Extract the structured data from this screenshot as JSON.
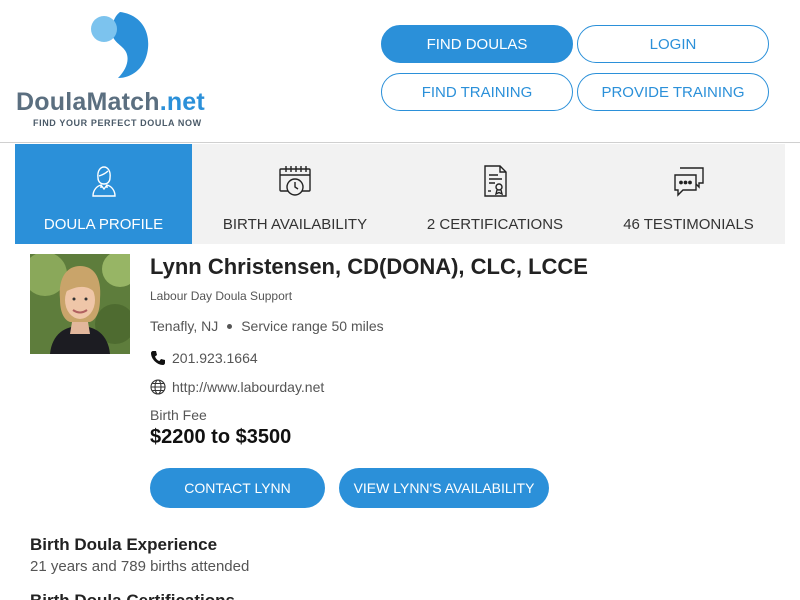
{
  "brand": {
    "name_main": "DoulaMatch",
    "name_suffix": ".net",
    "tagline": "FIND YOUR PERFECT DOULA NOW",
    "accent_color": "#2b90d9"
  },
  "nav": {
    "find_doulas": "FIND DOULAS",
    "login": "LOGIN",
    "find_training": "FIND TRAINING",
    "provide_training": "PROVIDE TRAINING"
  },
  "tabs": [
    {
      "label": "DOULA PROFILE",
      "icon": "doula-person-icon",
      "active": true
    },
    {
      "label": "BIRTH AVAILABILITY",
      "icon": "calendar-clock-icon",
      "active": false
    },
    {
      "label": "2 CERTIFICATIONS",
      "icon": "certificate-icon",
      "active": false
    },
    {
      "label": "46 TESTIMONIALS",
      "icon": "chat-bubbles-icon",
      "active": false
    }
  ],
  "profile": {
    "name": "Lynn Christensen, CD(DONA), CLC, LCCE",
    "business": "Labour Day Doula Support",
    "location": "Tenafly, NJ",
    "service_range": "Service range 50 miles",
    "phone": "201.923.1664",
    "website": "http://www.labourday.net",
    "fee_label": "Birth Fee",
    "fee_value": "$2200 to $3500"
  },
  "actions": {
    "contact": "CONTACT LYNN",
    "availability": "VIEW LYNN'S AVAILABILITY"
  },
  "sections": {
    "experience_title": "Birth Doula Experience",
    "experience_text": "21 years and 789 births attended",
    "next_title": "Birth Doula Certifications"
  }
}
